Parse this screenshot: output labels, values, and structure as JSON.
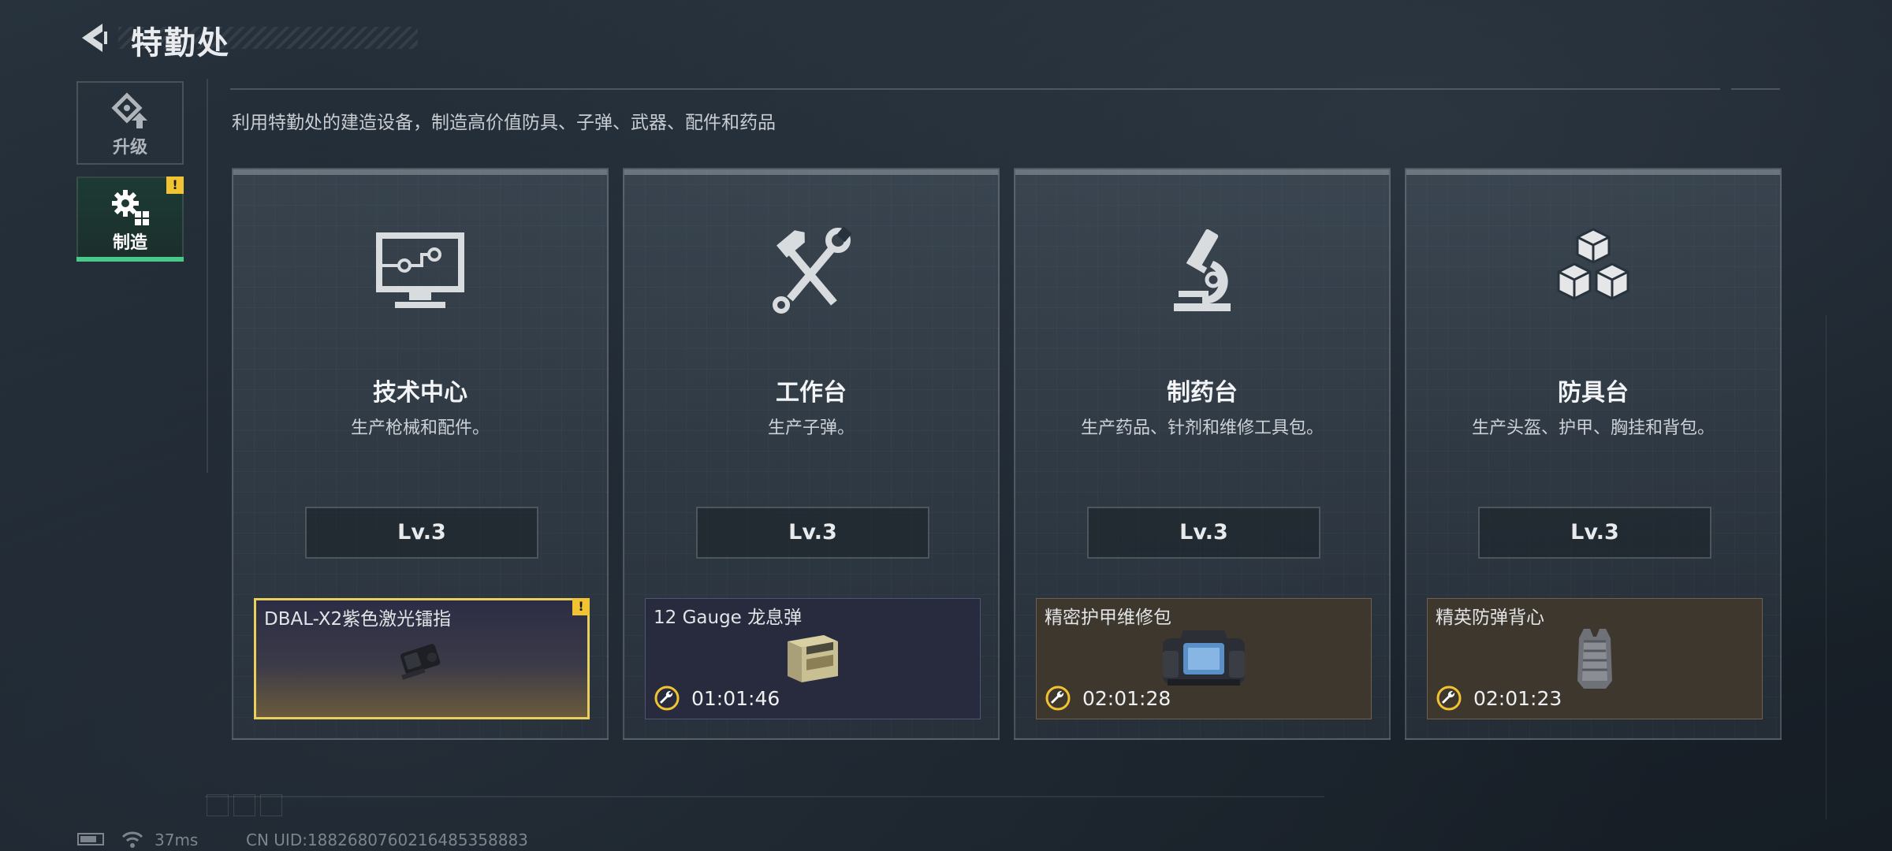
{
  "header": {
    "title": "特勤处"
  },
  "subtitle": "利用特勤处的建造设备，制造高价值防具、子弹、武器、配件和药品",
  "sidebar": {
    "items": [
      {
        "label": "升级",
        "icon": "upgrade-icon"
      },
      {
        "label": "制造",
        "icon": "craft-gear-icon",
        "active": true,
        "alert": "!"
      }
    ]
  },
  "stations": [
    {
      "name": "技术中心",
      "description": "生产枪械和配件。",
      "level": "Lv.3",
      "icon": "computer-icon",
      "task": {
        "item": "DBAL-X2紫色激光镭指",
        "timer": "",
        "alert": "!",
        "highlight_color": "#e9cf5c"
      }
    },
    {
      "name": "工作台",
      "description": "生产子弹。",
      "level": "Lv.3",
      "icon": "hammer-wrench-icon",
      "task": {
        "item": "12 Gauge 龙息弹",
        "timer": "01:01:46"
      }
    },
    {
      "name": "制药台",
      "description": "生产药品、针剂和维修工具包。",
      "level": "Lv.3",
      "icon": "microscope-icon",
      "task": {
        "item": "精密护甲维修包",
        "timer": "02:01:28"
      }
    },
    {
      "name": "防具台",
      "description": "生产头盔、护甲、胸挂和背包。",
      "level": "Lv.3",
      "icon": "cubes-icon",
      "task": {
        "item": "精英防弹背心",
        "timer": "02:01:23"
      }
    }
  ],
  "status_bar": {
    "ping": "37ms",
    "uid": "CN UID:1882680760216485358883"
  },
  "colors": {
    "active_tab": "#49c989",
    "alert": "#f1c232",
    "timer_icon": "#f1c232"
  }
}
